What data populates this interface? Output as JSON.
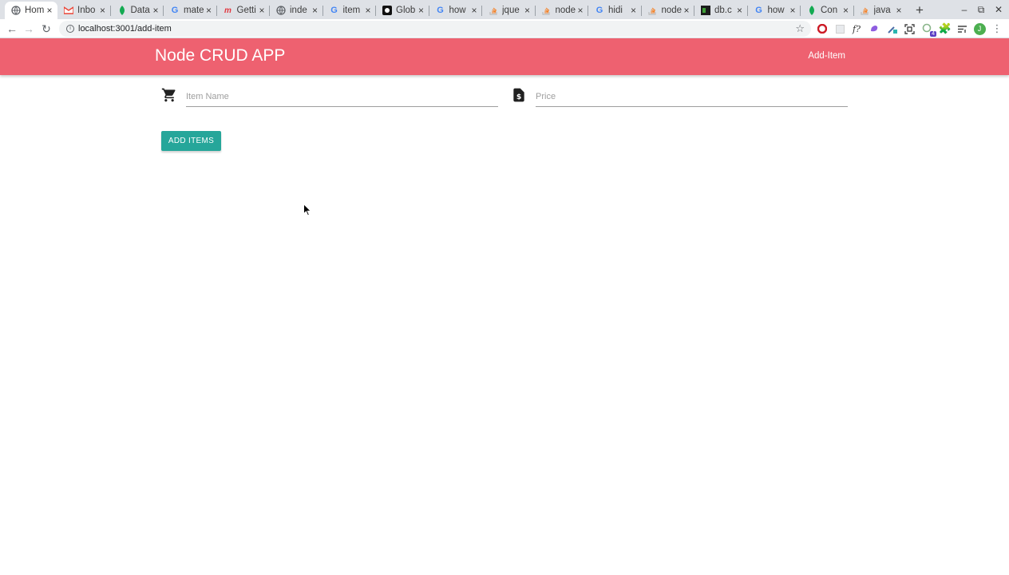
{
  "browser": {
    "tabs": [
      {
        "label": "Hom",
        "icon": "globe-icon",
        "active": true
      },
      {
        "label": "Inbo",
        "icon": "gmail-icon"
      },
      {
        "label": "Data",
        "icon": "leaf-icon"
      },
      {
        "label": "mate",
        "icon": "google-icon"
      },
      {
        "label": "Getti",
        "icon": "m-logo-icon"
      },
      {
        "label": "inde",
        "icon": "globe-icon"
      },
      {
        "label": "item",
        "icon": "google-icon"
      },
      {
        "label": "Glob",
        "icon": "github-icon"
      },
      {
        "label": "how",
        "icon": "google-icon"
      },
      {
        "label": "jque",
        "icon": "stackoverflow-icon"
      },
      {
        "label": "node",
        "icon": "stackoverflow-icon"
      },
      {
        "label": "hidi",
        "icon": "google-icon"
      },
      {
        "label": "node",
        "icon": "stackoverflow-icon"
      },
      {
        "label": "db.c",
        "icon": "terminal-icon"
      },
      {
        "label": "how",
        "icon": "google-icon"
      },
      {
        "label": "Con",
        "icon": "leaf-icon"
      },
      {
        "label": "java",
        "icon": "stackoverflow-icon"
      }
    ],
    "url": "localhost:3001/add-item",
    "profile_initial": "J",
    "extension_badge": "4"
  },
  "app": {
    "brand": "Node CRUD APP",
    "nav_link": "Add-Item",
    "item_name_placeholder": "Item Name",
    "price_placeholder": "Price",
    "submit_label": "ADD ITEMS"
  },
  "colors": {
    "appbar": "#ee6170",
    "button": "#26a69a"
  }
}
